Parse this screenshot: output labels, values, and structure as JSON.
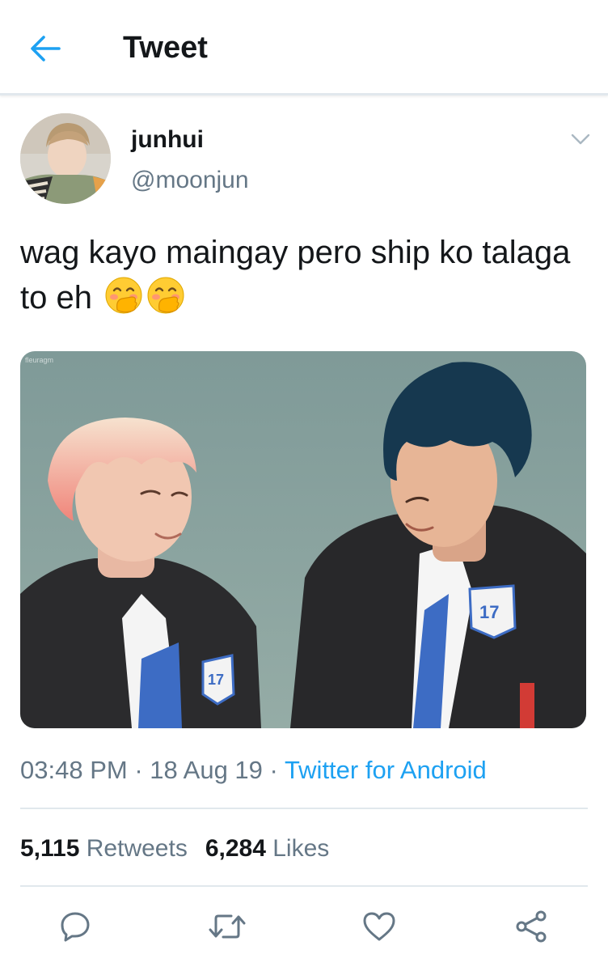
{
  "header": {
    "title": "Tweet",
    "back_icon": "arrow-left-icon"
  },
  "tweet": {
    "author": {
      "display_name": "junhui",
      "handle": "@moonjun"
    },
    "text": "wag kayo maingay pero ship ko talaga to eh",
    "emojis": [
      "face-with-hand-over-mouth-emoji",
      "face-with-hand-over-mouth-emoji"
    ],
    "media": {
      "watermark": "fleuragm"
    },
    "time": "03:48 PM",
    "date": "18 Aug 19",
    "separator": "·",
    "source": "Twitter for Android",
    "stats": {
      "retweets_count": "5,115",
      "retweets_label": "Retweets",
      "likes_count": "6,284",
      "likes_label": "Likes"
    }
  },
  "actions": [
    "reply-icon",
    "retweet-icon",
    "like-icon",
    "share-icon"
  ],
  "colors": {
    "accent": "#1da1f2",
    "text_primary": "#14171a",
    "text_secondary": "#657786",
    "divider": "#e1e8ed"
  }
}
